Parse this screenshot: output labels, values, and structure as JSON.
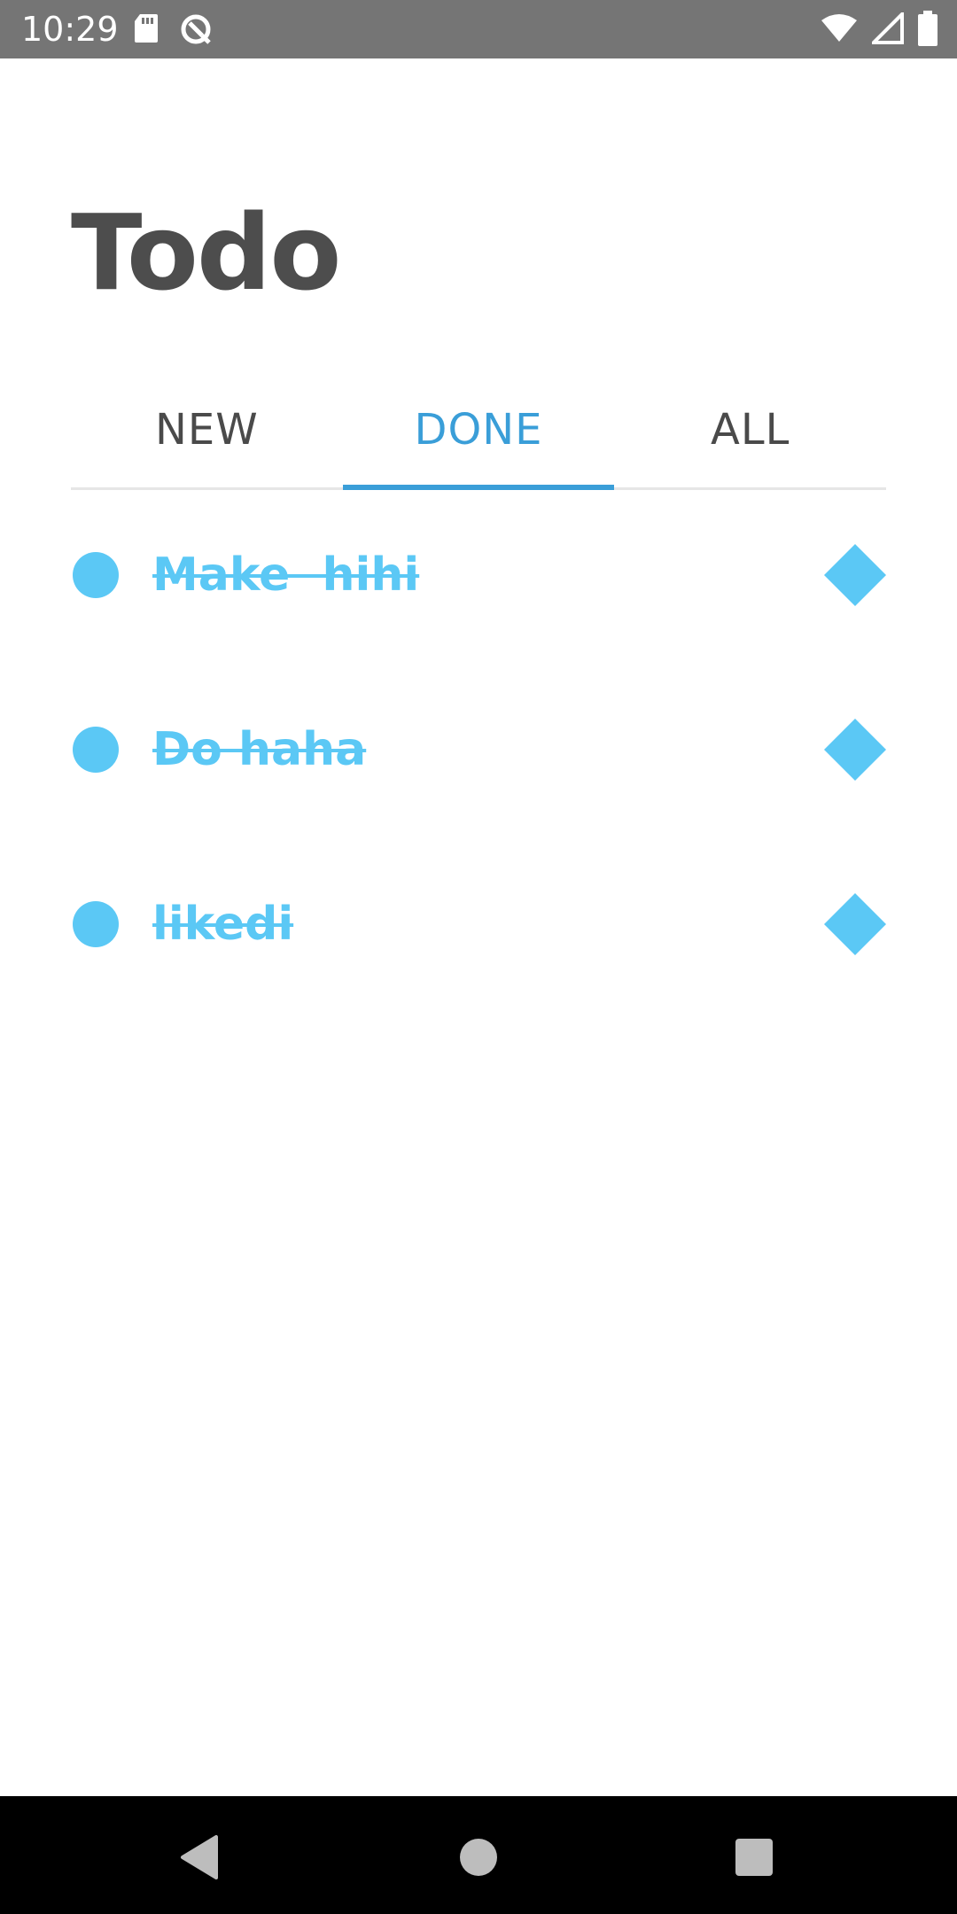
{
  "status_bar": {
    "time": "10:29",
    "left_icons": [
      "sd-card-icon",
      "data-saver-icon"
    ],
    "right_icons": [
      "wifi-icon",
      "cell-signal-icon",
      "battery-icon"
    ]
  },
  "header": {
    "title": "Todo"
  },
  "tabs": [
    {
      "label": "NEW",
      "active": false
    },
    {
      "label": "DONE",
      "active": true
    },
    {
      "label": "ALL",
      "active": false
    }
  ],
  "todos": [
    {
      "label": "Make  hihi",
      "done": true
    },
    {
      "label": "Do haha",
      "done": true
    },
    {
      "label": "likedi",
      "done": true
    }
  ],
  "colors": {
    "accent": "#3a9ed8",
    "item": "#5bc8f5",
    "title": "#4d4d4d",
    "status_bar": "#757575",
    "nav_bar": "#000000"
  },
  "nav_bar": {
    "buttons": [
      "back-icon",
      "home-icon",
      "recents-icon"
    ]
  }
}
